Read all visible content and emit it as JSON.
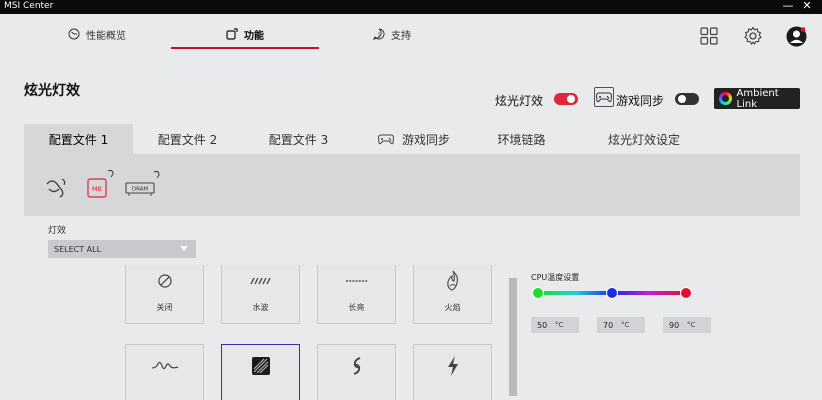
{
  "window": {
    "title": "MSI Center",
    "minimize": "—",
    "close": "✕"
  },
  "nav": {
    "tabs": [
      {
        "label": "性能概览",
        "icon": "gauge-icon"
      },
      {
        "label": "功能",
        "icon": "feature-icon"
      },
      {
        "label": "支持",
        "icon": "help-icon"
      }
    ],
    "active": 1,
    "accent": "#c8102e",
    "right_icons": [
      "grid-icon",
      "gear-icon",
      "avatar"
    ]
  },
  "page": {
    "title": "炫光灯效",
    "mystic_light_label": "炫光灯效",
    "mystic_light_on": true,
    "game_sync_label": "游戏同步",
    "game_sync_on": false,
    "ambient_link_label": "Ambient Link"
  },
  "sub_tabs": [
    {
      "label": "配置文件 1"
    },
    {
      "label": "配置文件 2"
    },
    {
      "label": "配置文件 3"
    },
    {
      "label": "游戏同步",
      "icon": "gamepad-icon"
    },
    {
      "label": "环境链路"
    },
    {
      "label": "炫光灯效设定"
    }
  ],
  "devices": [
    {
      "name": "link-device-icon",
      "label": ""
    },
    {
      "name": "motherboard-icon",
      "label": "MB"
    },
    {
      "name": "dram-icon",
      "label": "DRAM"
    }
  ],
  "effects": {
    "label": "灯效",
    "select_value": "SELECT ALL",
    "tiles": [
      {
        "label": "关闭",
        "icon": "off-icon"
      },
      {
        "label": "水波",
        "icon": "wave-icon"
      },
      {
        "label": "长亮",
        "icon": "steady-icon"
      },
      {
        "label": "火焰",
        "icon": "flame-icon"
      },
      {
        "label": "",
        "icon": "breathing-icon"
      },
      {
        "label": "",
        "icon": "rainbow-icon"
      },
      {
        "label": "",
        "icon": "cycle-icon"
      },
      {
        "label": "",
        "icon": "lightning-icon"
      }
    ],
    "selected_index": 5
  },
  "cpu_temp": {
    "title": "CPU温度设置",
    "values": [
      {
        "value": "50",
        "unit": "°C",
        "color": "#1fdc2a"
      },
      {
        "value": "70",
        "unit": "°C",
        "color": "#1a2fe0"
      },
      {
        "value": "90",
        "unit": "°C",
        "color": "#e0102a"
      }
    ]
  }
}
